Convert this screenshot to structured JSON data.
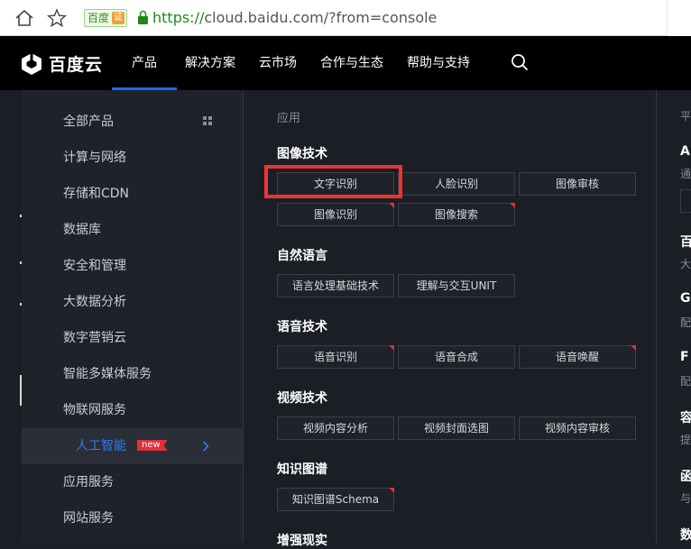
{
  "browser": {
    "home_icon": "home-icon",
    "star_icon": "star-icon",
    "site_badge": "百度",
    "cert_badge": "证",
    "lock_icon": "lock-icon",
    "url_scheme": "https://",
    "url_rest": "cloud.baidu.com/?from=console"
  },
  "topnav": {
    "logo_text": "百度云",
    "items": [
      "产品",
      "解决方案",
      "云市场",
      "合作与生态",
      "帮助与支持"
    ],
    "active_index": 0,
    "search_icon": "search-icon"
  },
  "sidebar": {
    "items": [
      "全部产品",
      "计算与网络",
      "存储和CDN",
      "数据库",
      "安全和管理",
      "大数据分析",
      "数字营销云",
      "智能多媒体服务",
      "物联网服务",
      "人工智能",
      "应用服务",
      "网站服务"
    ],
    "active_index": 9,
    "new_badge": "new"
  },
  "main": {
    "column_label": "应用",
    "sections": [
      {
        "title": "图像技术",
        "chips": [
          "文字识别",
          "人脸识别",
          "图像审核",
          "图像识别",
          "图像搜索"
        ]
      },
      {
        "title": "自然语言",
        "chips": [
          "语言处理基础技术",
          "理解与交互UNIT"
        ]
      },
      {
        "title": "语音技术",
        "chips": [
          "语音识别",
          "语音合成",
          "语音唤醒"
        ]
      },
      {
        "title": "视频技术",
        "chips": [
          "视频内容分析",
          "视频封面选图",
          "视频内容审核"
        ]
      },
      {
        "title": "知识图谱",
        "chips": [
          "知识图谱Schema"
        ]
      },
      {
        "title": "增强现实",
        "chips": []
      }
    ]
  },
  "right_panel": {
    "label": "平",
    "texts": [
      "Ap",
      "百",
      "G",
      "F",
      "容",
      "函",
      "数"
    ],
    "subs": [
      "通",
      "大",
      "配",
      "配",
      "提",
      "与"
    ]
  },
  "colors": {
    "accent": "#2468f2",
    "highlight": "#ee3234",
    "new_badge": "#e0313a",
    "nav_bg": "#000000",
    "panel_bg": "#1b1e25"
  }
}
